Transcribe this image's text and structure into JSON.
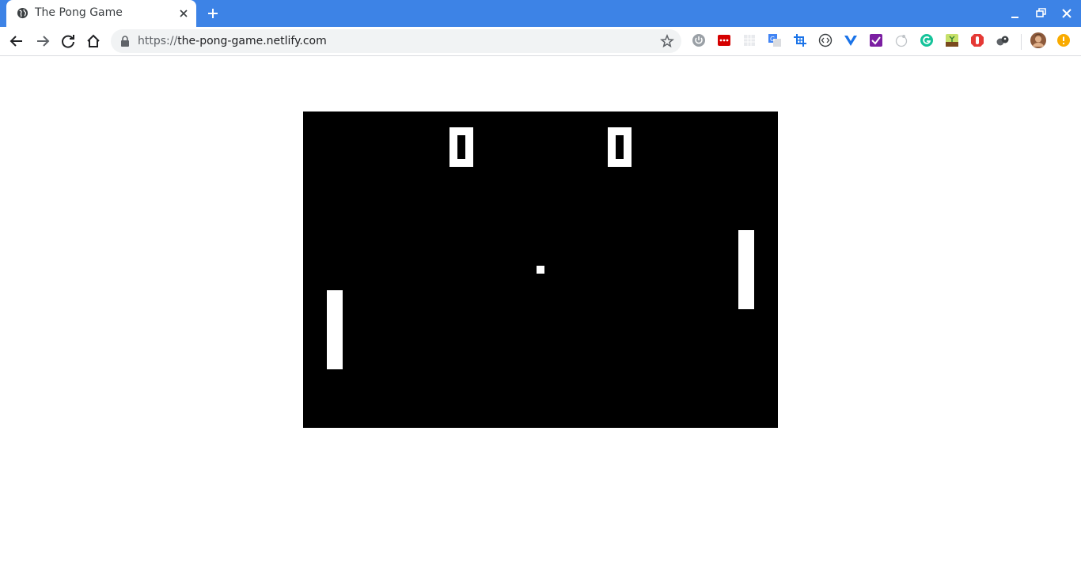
{
  "browser": {
    "tab_title": "The Pong Game",
    "url_scheme": "https://",
    "url_host": "the-pong-game.netlify.com",
    "icons": {
      "favicon": "globe-icon",
      "close": "close-icon",
      "new_tab": "plus-icon",
      "back": "back-arrow-icon",
      "forward": "forward-arrow-icon",
      "reload": "reload-icon",
      "home": "home-icon",
      "secure": "lock-icon",
      "bookmark": "star-icon"
    },
    "extensions": [
      "power-extension-icon",
      "red-dots-extension-icon",
      "grid-extension-icon",
      "translate-extension-icon",
      "crop-extension-icon",
      "code-extension-icon",
      "vue-extension-icon",
      "purple-check-extension-icon",
      "circle-extension-icon",
      "grammarly-extension-icon",
      "plant-extension-icon",
      "stop-hand-extension-icon",
      "pen-extension-icon"
    ],
    "colors": {
      "tabstrip": "#3d83e6",
      "omnibox": "#f1f3f4"
    }
  },
  "game": {
    "score_left": "0",
    "score_right": "0",
    "colors": {
      "field": "#000000",
      "foreground": "#ffffff"
    }
  }
}
